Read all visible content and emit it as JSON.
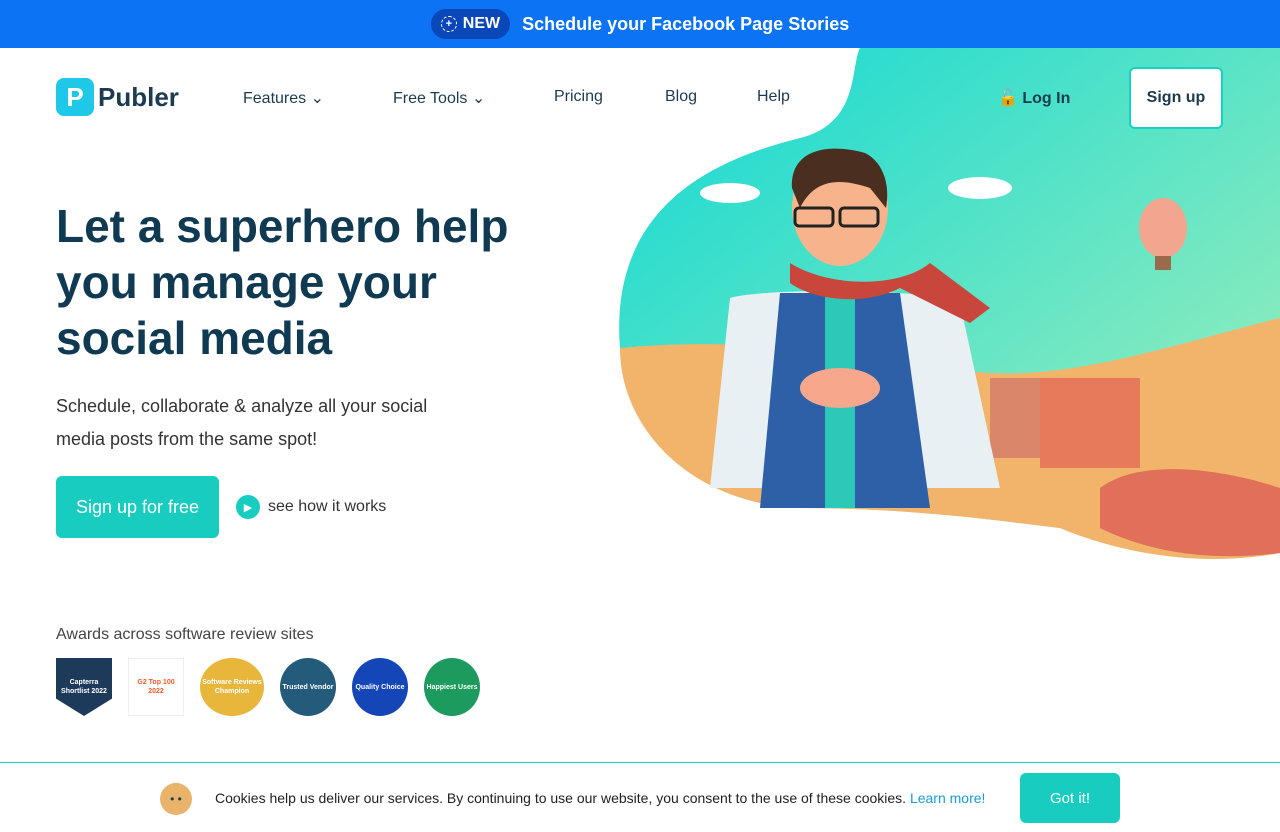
{
  "announcement": {
    "badge": "NEW",
    "message": "Schedule your Facebook Page Stories"
  },
  "nav": {
    "logo": "Publer",
    "items": [
      {
        "label": "Features",
        "dropdown": true
      },
      {
        "label": "Free Tools",
        "dropdown": true
      },
      {
        "label": "Pricing"
      },
      {
        "label": "Blog"
      },
      {
        "label": "Help"
      }
    ],
    "login": "Log In",
    "signup": "Sign up"
  },
  "hero": {
    "title": "Let a superhero help you manage your social media",
    "subtitle": "Schedule, collaborate & analyze all your social media posts from the same spot!",
    "cta": "Sign up for free",
    "video_link": "see how it works"
  },
  "awards": {
    "title": "Awards across software review sites",
    "badges": [
      {
        "name": "Capterra Shortlist 2022",
        "color": "#1e3a5a"
      },
      {
        "name": "G2 Top 100 2022",
        "color": "#f25a2b"
      },
      {
        "name": "Software Reviews Champion",
        "color": "#e8b63a"
      },
      {
        "name": "Trusted Vendor",
        "color": "#245a7a"
      },
      {
        "name": "Quality Choice",
        "color": "#1546b8"
      },
      {
        "name": "Happiest Users",
        "color": "#1d9a5e"
      }
    ]
  },
  "cookie": {
    "text": "Cookies help us deliver our services. By continuing to use our website, you consent to the use of these cookies.",
    "link": "Learn more!",
    "button": "Got it!"
  },
  "colors": {
    "brand_blue": "#0d73f5",
    "accent_teal": "#18ccbf",
    "text_dark": "#103a52"
  }
}
